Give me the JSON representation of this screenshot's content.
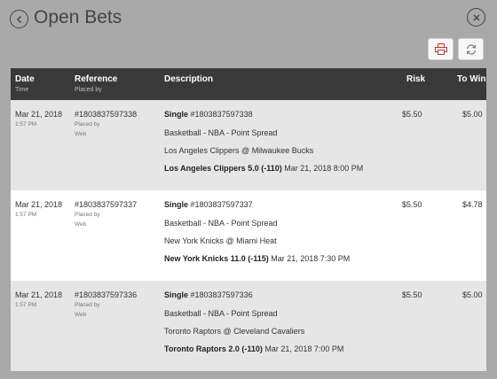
{
  "header": {
    "title": "Open Bets"
  },
  "icons": {
    "back": "chevron-left-circle",
    "close": "x-circle",
    "print": "printer",
    "refresh": "refresh-arrows"
  },
  "colors": {
    "accent_red": "#c0392b",
    "header_bg": "#393939"
  },
  "table": {
    "columns": {
      "date": "Date",
      "date_sub": "Time",
      "reference": "Reference",
      "reference_sub": "Placed by",
      "description": "Description",
      "risk": "Risk",
      "to_win": "To Win"
    },
    "rows": [
      {
        "date": "Mar 21, 2018",
        "time": "1:57 PM",
        "reference": "#1803837597338",
        "placed_by_label": "Placed by",
        "placed_by": "Web",
        "bet_type": "Single",
        "bet_ref": "#1803837597338",
        "sport_line": "Basketball - NBA - Point Spread",
        "matchup": "Los Angeles Clippers @ Milwaukee Bucks",
        "selection": "Los Angeles Clippers 5.0 (-110)",
        "event_time": "Mar 21, 2018 8:00 PM",
        "risk": "$5.50",
        "to_win": "$5.00"
      },
      {
        "date": "Mar 21, 2018",
        "time": "1:57 PM",
        "reference": "#1803837597337",
        "placed_by_label": "Placed by",
        "placed_by": "Web",
        "bet_type": "Single",
        "bet_ref": "#1803837597337",
        "sport_line": "Basketball - NBA - Point Spread",
        "matchup": "New York Knicks @ Miami Heat",
        "selection": "New York Knicks 11.0 (-115)",
        "event_time": "Mar 21, 2018 7:30 PM",
        "risk": "$5.50",
        "to_win": "$4.78"
      },
      {
        "date": "Mar 21, 2018",
        "time": "1:57 PM",
        "reference": "#1803837597336",
        "placed_by_label": "Placed by",
        "placed_by": "Web",
        "bet_type": "Single",
        "bet_ref": "#1803837597336",
        "sport_line": "Basketball - NBA - Point Spread",
        "matchup": "Toronto Raptors @ Cleveland Cavaliers",
        "selection": "Toronto Raptors 2.0 (-110)",
        "event_time": "Mar 21, 2018 7:00 PM",
        "risk": "$5.50",
        "to_win": "$5.00"
      }
    ]
  }
}
